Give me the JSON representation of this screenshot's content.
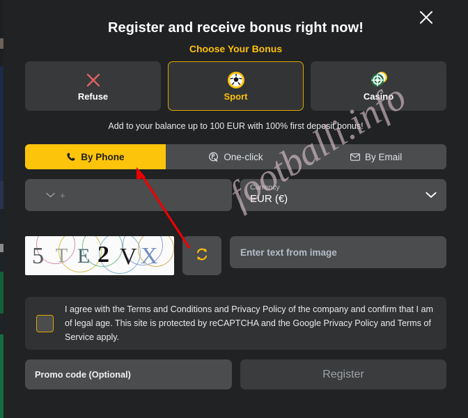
{
  "modal": {
    "title": "Register and receive bonus right now!",
    "subtitle": "Choose Your Bonus",
    "close_icon": "close-icon",
    "promo_line": "Add to your balance up to 100 EUR with 100% first deposit bonus!"
  },
  "bonus_cards": [
    {
      "label": "Refuse",
      "icon": "cross-icon",
      "selected": false
    },
    {
      "label": "Sport",
      "icon": "soccer-ball-icon",
      "selected": true
    },
    {
      "label": "Casino",
      "icon": "poker-chip-icon",
      "selected": false
    }
  ],
  "tabs": [
    {
      "label": "By Phone",
      "icon": "phone-icon",
      "active": true
    },
    {
      "label": "One-click",
      "icon": "one-click-icon",
      "active": false
    },
    {
      "label": "By Email",
      "icon": "envelope-icon",
      "active": false
    }
  ],
  "phone": {
    "country_chevron": "chevron-down-icon",
    "placeholder": "+",
    "value": ""
  },
  "currency": {
    "label": "Currency",
    "value": "EUR (€)",
    "chevron": "chevron-down-icon"
  },
  "captcha": {
    "text": "5TE2VX",
    "characters": [
      "5",
      "T",
      "E",
      "2",
      "V",
      "X"
    ],
    "refresh_icon": "refresh-icon",
    "input_placeholder": "Enter text from image",
    "input_value": ""
  },
  "terms": {
    "checked": false,
    "text": "I agree with the Terms and Conditions and Privacy Policy of the company and confirm that I am of legal age. This site is protected by reCAPTCHA and the Google Privacy Policy and Terms of Service apply."
  },
  "bottom": {
    "promo_placeholder": "Promo code (Optional)",
    "promo_value": "",
    "register_label": "Register"
  },
  "watermark": {
    "text": "footballi.info"
  },
  "colors": {
    "accent_yellow": "#fdc40c",
    "subtitle_yellow": "#fdc10a",
    "modal_bg": "#202224",
    "field_bg": "#4a4c4e",
    "card_bg": "#37393b",
    "refuse_red": "#e06060",
    "annotation_red": "#ee0000"
  }
}
